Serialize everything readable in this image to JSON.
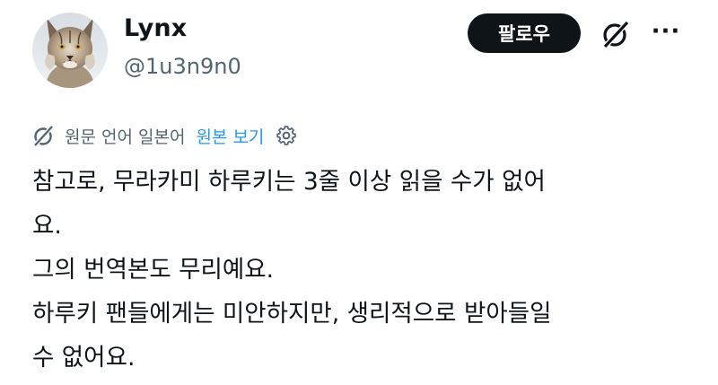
{
  "user": {
    "display_name": "Lynx",
    "handle": "@1u3n9n0",
    "avatar_icon": "lynx-avatar"
  },
  "actions": {
    "follow_label": "팔로우",
    "grok_icon": "grok-icon",
    "more_label": "···"
  },
  "translation": {
    "icon": "grok-translate-icon",
    "label": "원문 언어 일본어",
    "show_original_label": "원본 보기",
    "settings_icon": "gear-icon",
    "link_color": "#1d9bf0"
  },
  "tweet": {
    "lines": [
      "참고로, 무라카미 하루키는 3줄 이상 읽을 수가 없어",
      "요.",
      "그의 번역본도 무리예요.",
      "하루키 팬들에게는 미안하지만, 생리적으로 받아들일",
      "수 없어요."
    ]
  },
  "colors": {
    "text_primary": "#0f1419",
    "text_secondary": "#536471",
    "button_bg": "#0f1419",
    "accent": "#1d9bf0"
  }
}
